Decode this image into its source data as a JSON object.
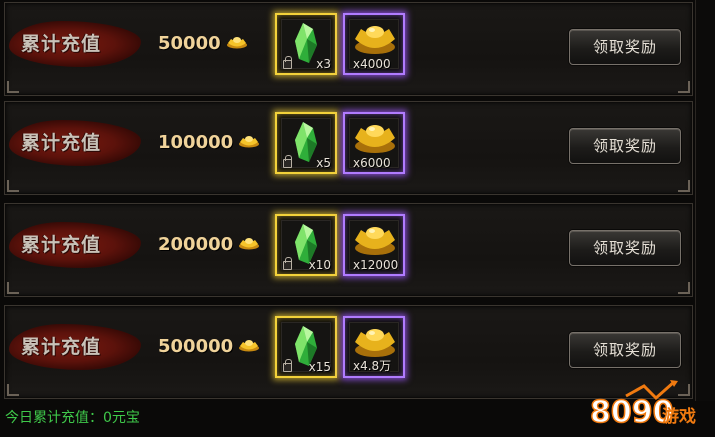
{
  "rows": [
    {
      "banner": "累计充值",
      "amount": "50000",
      "item1_qty": "x3",
      "item2_qty": "x4000",
      "button": "领取奖励"
    },
    {
      "banner": "累计充值",
      "amount": "100000",
      "item1_qty": "x5",
      "item2_qty": "x6000",
      "button": "领取奖励"
    },
    {
      "banner": "累计充值",
      "amount": "200000",
      "item1_qty": "x10",
      "item2_qty": "x12000",
      "button": "领取奖励"
    },
    {
      "banner": "累计充值",
      "amount": "500000",
      "item1_qty": "x15",
      "item2_qty": "x4.8万",
      "button": "领取奖励"
    }
  ],
  "footer": {
    "today_label": "今日累计充值：0元宝"
  },
  "logo": {
    "text": "8090游戏"
  },
  "colors": {
    "gold_frame": "#f3d23a",
    "purple_frame": "#b07bff",
    "footer_green": "#3fc84a",
    "amount_gold": "#f0d39a"
  }
}
